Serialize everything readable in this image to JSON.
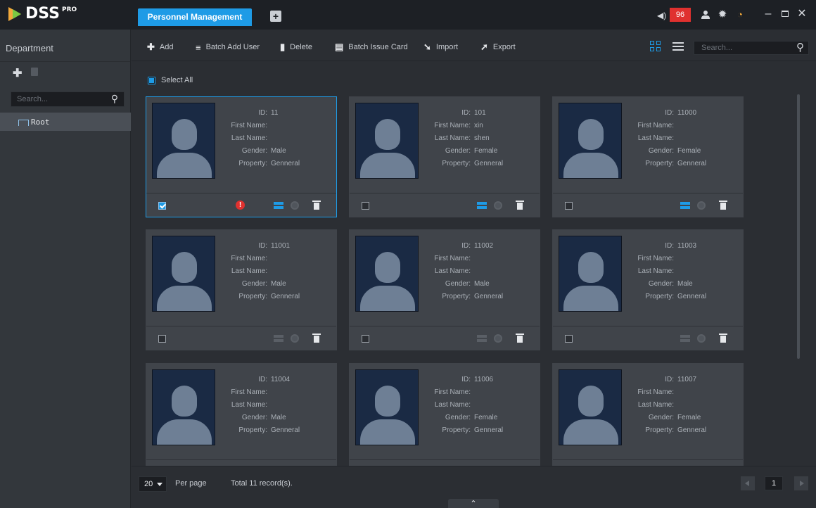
{
  "app": {
    "brand": "DSS",
    "brand_suffix": "PRO"
  },
  "tabs": [
    {
      "label": "Personnel Management",
      "active": true
    }
  ],
  "system": {
    "alarm_count": "96",
    "accent": "#1e9be6",
    "alarm_color": "#e0312f"
  },
  "sidebar": {
    "title": "Department",
    "search_placeholder": "Search...",
    "tree": [
      {
        "label": "Root"
      }
    ]
  },
  "toolbar": {
    "add": "Add",
    "batch_add_user": "Batch Add User",
    "delete": "Delete",
    "batch_issue_card": "Batch Issue Card",
    "import": "Import",
    "export": "Export",
    "search_placeholder": "Search..."
  },
  "content": {
    "select_all": "Select All",
    "labels": {
      "id": "ID:",
      "first_name": "First Name:",
      "last_name": "Last Name:",
      "gender": "Gender:",
      "property": "Property:"
    },
    "cards": [
      {
        "id": "11",
        "first_name": "",
        "last_name": "",
        "gender": "Male",
        "property": "Genneral",
        "checked": true,
        "warning": true,
        "card_issued": true
      },
      {
        "id": "101",
        "first_name": "xin",
        "last_name": "shen",
        "gender": "Female",
        "property": "Genneral",
        "checked": false,
        "warning": false,
        "card_issued": true
      },
      {
        "id": "11000",
        "first_name": "",
        "last_name": "",
        "gender": "Female",
        "property": "Genneral",
        "checked": false,
        "warning": false,
        "card_issued": true
      },
      {
        "id": "11001",
        "first_name": "",
        "last_name": "",
        "gender": "Male",
        "property": "Genneral",
        "checked": false,
        "warning": false,
        "card_issued": false
      },
      {
        "id": "11002",
        "first_name": "",
        "last_name": "",
        "gender": "Male",
        "property": "Genneral",
        "checked": false,
        "warning": false,
        "card_issued": false
      },
      {
        "id": "11003",
        "first_name": "",
        "last_name": "",
        "gender": "Male",
        "property": "Genneral",
        "checked": false,
        "warning": false,
        "card_issued": false
      },
      {
        "id": "11004",
        "first_name": "",
        "last_name": "",
        "gender": "Male",
        "property": "Genneral",
        "checked": false,
        "warning": false,
        "card_issued": false
      },
      {
        "id": "11006",
        "first_name": "",
        "last_name": "",
        "gender": "Female",
        "property": "Genneral",
        "checked": false,
        "warning": false,
        "card_issued": false
      },
      {
        "id": "11007",
        "first_name": "",
        "last_name": "",
        "gender": "Female",
        "property": "Genneral",
        "checked": false,
        "warning": false,
        "card_issued": false
      }
    ]
  },
  "pagination": {
    "per_page_value": "20",
    "per_page_label": "Per page",
    "total": "Total 11 record(s).",
    "current_page": "1"
  }
}
